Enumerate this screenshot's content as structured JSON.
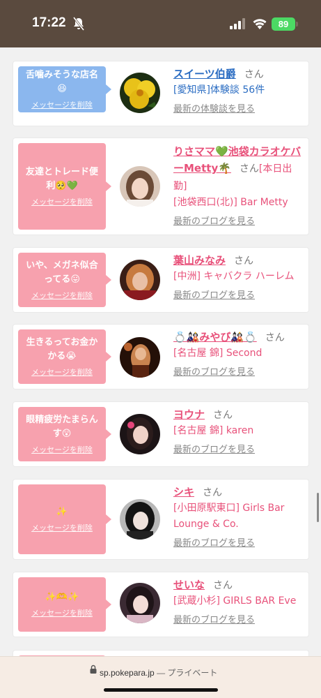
{
  "status_bar": {
    "time": "17:22",
    "battery": "89"
  },
  "browser": {
    "url": "sp.pokepara.jp",
    "separator": " — ",
    "private_label": "プライベート"
  },
  "cards": [
    {
      "message": "舌噛みそうな店名😆",
      "delete_label": "メッセージを削除",
      "name": "スイーツ伯爵",
      "san": "さん",
      "meta": "[愛知県]体験談 56件",
      "more": "最新の体験談を見る"
    },
    {
      "message": "友達とトレード便利🥺💚",
      "delete_label": "メッセージを削除",
      "name": "りさママ💚池袋カラオケバーMetty🌴",
      "san": "さん",
      "meta_extra": "[本日出勤]",
      "meta": "[池袋西口(北)] Bar Metty",
      "more": "最新のブログを見る"
    },
    {
      "message": "いや、メガネ似合ってる😛",
      "delete_label": "メッセージを削除",
      "name": "葉山みなみ",
      "san": "さん",
      "meta": "[中洲] キャバクラ ハーレム",
      "more": "最新のブログを見る"
    },
    {
      "message": "生きるってお金かかる😭",
      "delete_label": "メッセージを削除",
      "name": "💍🎎みやび🎎💍",
      "san": "さん",
      "meta": "[名古屋 錦] Second",
      "more": "最新のブログを見る"
    },
    {
      "message": "眼精疲労たまらんす😲",
      "delete_label": "メッセージを削除",
      "name": "ヨウナ",
      "san": "さん",
      "meta": "[名古屋 錦] karen",
      "more": "最新のブログを見る"
    },
    {
      "message": "✨",
      "delete_label": "メッセージを削除",
      "name": "シキ",
      "san": "さん",
      "meta": "[小田原駅東口] Girls Bar Lounge & Co.",
      "more": "最新のブログを見る"
    },
    {
      "message": "✨🫶✨",
      "delete_label": "メッセージを削除",
      "name": "せいな",
      "san": "さん",
      "meta": "[武蔵小杉] GIRLS BAR Eve",
      "more": "最新のブログを見る"
    }
  ],
  "colors": {
    "status_bg": "#5a4a3e",
    "blue_bubble": "#8bb7ee",
    "pink_bubble": "#f7a1ae",
    "blue_text": "#2a6cc2",
    "pink_text": "#e8517a"
  }
}
